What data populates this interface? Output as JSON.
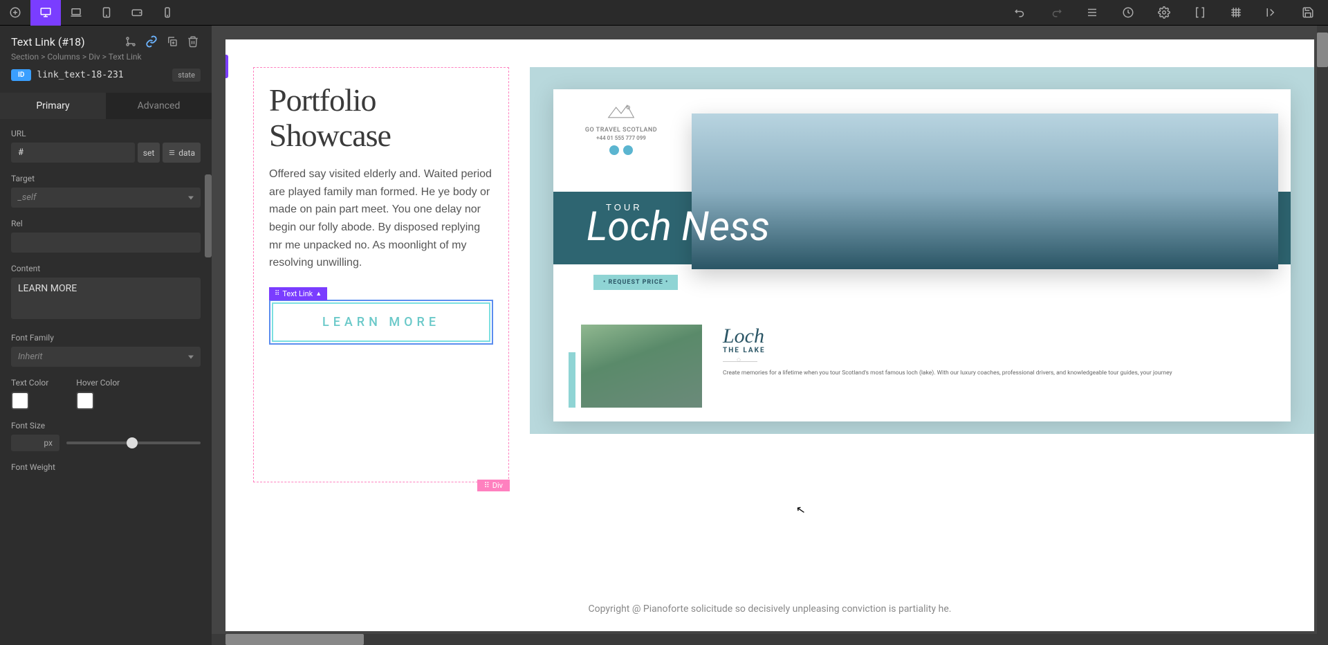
{
  "toolbar": {},
  "inspector": {
    "title": "Text Link (#18)",
    "breadcrumb": {
      "parts": [
        "Section",
        "Columns",
        "Div",
        "Text Link"
      ]
    },
    "id_badge": "ID",
    "id_value": "link_text-18-231",
    "state_label": "state",
    "tabs": {
      "primary": "Primary",
      "advanced": "Advanced"
    },
    "labels": {
      "url": "URL",
      "target": "Target",
      "rel": "Rel",
      "content": "Content",
      "font_family": "Font Family",
      "text_color": "Text Color",
      "hover_color": "Hover Color",
      "font_size": "Font Size",
      "font_weight": "Font Weight"
    },
    "values": {
      "url": "#",
      "set_btn": "set",
      "data_btn": "data",
      "target": "_self",
      "rel": "",
      "content": "LEARN MORE",
      "font_family": "Inherit",
      "font_size_unit": "px",
      "text_color": "#ffffff",
      "hover_color": "#ffffff"
    }
  },
  "canvas": {
    "heading": "Portfolio Showcase",
    "paragraph": "Offered say visited elderly and. Waited period are played family man formed. He ye body or made on pain part meet. You one delay nor begin our folly abode. By disposed replying mr me unpacked no. As moonlight of my resolving unwilling.",
    "sel_tag": "Text Link",
    "learn_more": "LEARN MORE",
    "div_tag": "Div",
    "copyright": "Copyright @ Pianoforte solicitude so decisively unpleasing conviction is partiality he.",
    "preview": {
      "logo_name": "GO TRAVEL SCOTLAND",
      "logo_phone": "+44 01 555 777 099",
      "tour": "TOUR",
      "loch_ness": "Loch Ness",
      "request_price": "• REQUEST PRICE •",
      "loch": "Loch",
      "the_lake": "THE LAKE",
      "desc": "Create memories for a lifetime when you tour Scotland's most famous loch (lake). With our luxury coaches, professional drivers, and knowledgeable tour guides, your journey"
    }
  }
}
